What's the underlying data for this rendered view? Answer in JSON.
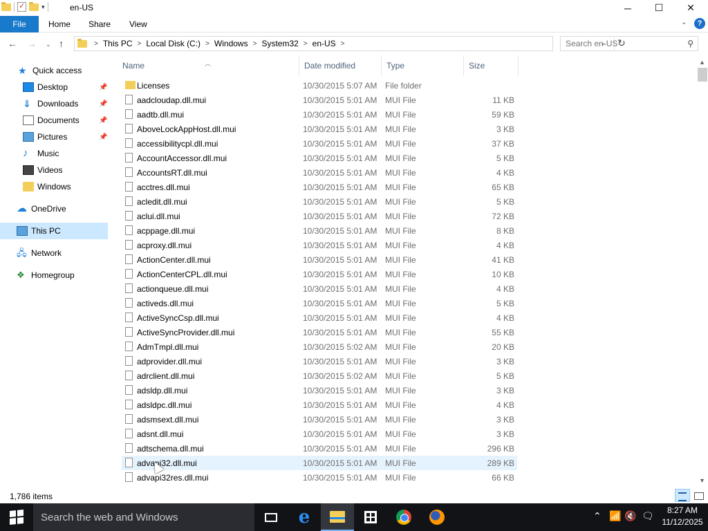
{
  "window": {
    "title": "en-US",
    "controls": {
      "minimize": "─",
      "maximize": "☐",
      "close": "✕"
    }
  },
  "ribbon": {
    "tabs": [
      "File",
      "Home",
      "Share",
      "View"
    ],
    "help": "?"
  },
  "nav": {
    "back": "←",
    "forward": "→",
    "recent": "⌄",
    "up": "↑"
  },
  "address": {
    "breadcrumbs": [
      "This PC",
      "Local Disk (C:)",
      "Windows",
      "System32",
      "en-US"
    ],
    "separator": ">"
  },
  "search": {
    "placeholder": "Search en-US"
  },
  "sidebar": {
    "items": [
      {
        "label": "Quick access",
        "icon": "star-icon",
        "pinned": false
      },
      {
        "label": "Desktop",
        "icon": "desktop-icon",
        "pinned": true
      },
      {
        "label": "Downloads",
        "icon": "download-icon",
        "pinned": true
      },
      {
        "label": "Documents",
        "icon": "documents-icon",
        "pinned": true
      },
      {
        "label": "Pictures",
        "icon": "pictures-icon",
        "pinned": true
      },
      {
        "label": "Music",
        "icon": "music-icon",
        "pinned": false
      },
      {
        "label": "Videos",
        "icon": "videos-icon",
        "pinned": false
      },
      {
        "label": "Windows",
        "icon": "folder-icon",
        "pinned": false
      },
      {
        "label": "OneDrive",
        "icon": "cloud-icon",
        "pinned": false
      },
      {
        "label": "This PC",
        "icon": "pc-icon",
        "pinned": false,
        "selected": true
      },
      {
        "label": "Network",
        "icon": "network-icon",
        "pinned": false
      },
      {
        "label": "Homegroup",
        "icon": "homegroup-icon",
        "pinned": false
      }
    ]
  },
  "columns": {
    "name": "Name",
    "date": "Date modified",
    "type": "Type",
    "size": "Size"
  },
  "files": [
    {
      "name": "Licenses",
      "date": "10/30/2015 5:07 AM",
      "type": "File folder",
      "size": ""
    },
    {
      "name": "aadcloudap.dll.mui",
      "date": "10/30/2015 5:01 AM",
      "type": "MUI File",
      "size": "11 KB"
    },
    {
      "name": "aadtb.dll.mui",
      "date": "10/30/2015 5:01 AM",
      "type": "MUI File",
      "size": "59 KB"
    },
    {
      "name": "AboveLockAppHost.dll.mui",
      "date": "10/30/2015 5:01 AM",
      "type": "MUI File",
      "size": "3 KB"
    },
    {
      "name": "accessibilitycpl.dll.mui",
      "date": "10/30/2015 5:01 AM",
      "type": "MUI File",
      "size": "37 KB"
    },
    {
      "name": "AccountAccessor.dll.mui",
      "date": "10/30/2015 5:01 AM",
      "type": "MUI File",
      "size": "5 KB"
    },
    {
      "name": "AccountsRT.dll.mui",
      "date": "10/30/2015 5:01 AM",
      "type": "MUI File",
      "size": "4 KB"
    },
    {
      "name": "acctres.dll.mui",
      "date": "10/30/2015 5:01 AM",
      "type": "MUI File",
      "size": "65 KB"
    },
    {
      "name": "acledit.dll.mui",
      "date": "10/30/2015 5:01 AM",
      "type": "MUI File",
      "size": "5 KB"
    },
    {
      "name": "aclui.dll.mui",
      "date": "10/30/2015 5:01 AM",
      "type": "MUI File",
      "size": "72 KB"
    },
    {
      "name": "acppage.dll.mui",
      "date": "10/30/2015 5:01 AM",
      "type": "MUI File",
      "size": "8 KB"
    },
    {
      "name": "acproxy.dll.mui",
      "date": "10/30/2015 5:01 AM",
      "type": "MUI File",
      "size": "4 KB"
    },
    {
      "name": "ActionCenter.dll.mui",
      "date": "10/30/2015 5:01 AM",
      "type": "MUI File",
      "size": "41 KB"
    },
    {
      "name": "ActionCenterCPL.dll.mui",
      "date": "10/30/2015 5:01 AM",
      "type": "MUI File",
      "size": "10 KB"
    },
    {
      "name": "actionqueue.dll.mui",
      "date": "10/30/2015 5:01 AM",
      "type": "MUI File",
      "size": "4 KB"
    },
    {
      "name": "activeds.dll.mui",
      "date": "10/30/2015 5:01 AM",
      "type": "MUI File",
      "size": "5 KB"
    },
    {
      "name": "ActiveSyncCsp.dll.mui",
      "date": "10/30/2015 5:01 AM",
      "type": "MUI File",
      "size": "4 KB"
    },
    {
      "name": "ActiveSyncProvider.dll.mui",
      "date": "10/30/2015 5:01 AM",
      "type": "MUI File",
      "size": "55 KB"
    },
    {
      "name": "AdmTmpl.dll.mui",
      "date": "10/30/2015 5:02 AM",
      "type": "MUI File",
      "size": "20 KB"
    },
    {
      "name": "adprovider.dll.mui",
      "date": "10/30/2015 5:01 AM",
      "type": "MUI File",
      "size": "3 KB"
    },
    {
      "name": "adrclient.dll.mui",
      "date": "10/30/2015 5:02 AM",
      "type": "MUI File",
      "size": "5 KB"
    },
    {
      "name": "adsldp.dll.mui",
      "date": "10/30/2015 5:01 AM",
      "type": "MUI File",
      "size": "3 KB"
    },
    {
      "name": "adsldpc.dll.mui",
      "date": "10/30/2015 5:01 AM",
      "type": "MUI File",
      "size": "4 KB"
    },
    {
      "name": "adsmsext.dll.mui",
      "date": "10/30/2015 5:01 AM",
      "type": "MUI File",
      "size": "3 KB"
    },
    {
      "name": "adsnt.dll.mui",
      "date": "10/30/2015 5:01 AM",
      "type": "MUI File",
      "size": "3 KB"
    },
    {
      "name": "adtschema.dll.mui",
      "date": "10/30/2015 5:01 AM",
      "type": "MUI File",
      "size": "296 KB"
    },
    {
      "name": "advapi32.dll.mui",
      "date": "10/30/2015 5:01 AM",
      "type": "MUI File",
      "size": "289 KB",
      "hover": true
    },
    {
      "name": "advapi32res.dll.mui",
      "date": "10/30/2015 5:01 AM",
      "type": "MUI File",
      "size": "66 KB"
    }
  ],
  "status": {
    "item_count": "1,786 items"
  },
  "taskbar": {
    "search_text": "Search the web and Windows",
    "apps": [
      "task-view-icon",
      "edge-icon",
      "file-explorer-icon",
      "store-icon",
      "chrome-icon",
      "firefox-icon"
    ],
    "tray": {
      "chevron": "⌃",
      "network": "📶",
      "volume": "🔇",
      "action_center": "🗨"
    },
    "time": "8:27 AM",
    "date": "11/12/2025"
  },
  "colors": {
    "accent": "#1979ca",
    "selection": "#cce8ff",
    "hover": "#e5f3ff",
    "taskbar": "#111317",
    "folder": "#f3cf59"
  }
}
